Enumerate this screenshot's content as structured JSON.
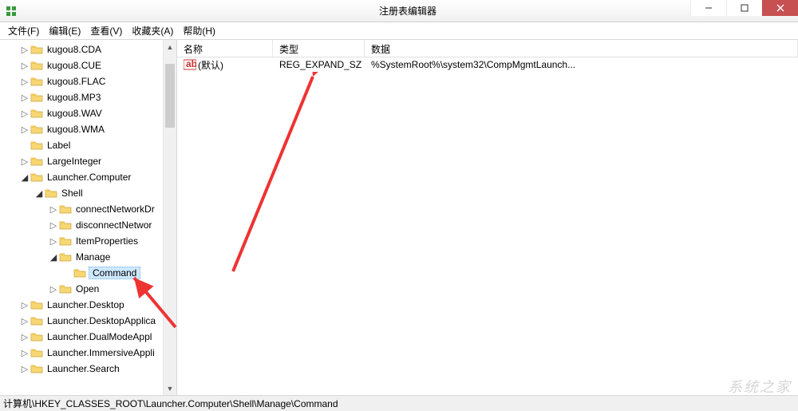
{
  "window": {
    "title": "注册表编辑器"
  },
  "menu": {
    "file": "文件(F)",
    "edit": "编辑(E)",
    "view": "查看(V)",
    "favorites": "收藏夹(A)",
    "help": "帮助(H)"
  },
  "tree": [
    {
      "indent": 0,
      "expander": "▷",
      "label": "kugou8.CDA"
    },
    {
      "indent": 0,
      "expander": "▷",
      "label": "kugou8.CUE"
    },
    {
      "indent": 0,
      "expander": "▷",
      "label": "kugou8.FLAC"
    },
    {
      "indent": 0,
      "expander": "▷",
      "label": "kugou8.MP3"
    },
    {
      "indent": 0,
      "expander": "▷",
      "label": "kugou8.WAV"
    },
    {
      "indent": 0,
      "expander": "▷",
      "label": "kugou8.WMA"
    },
    {
      "indent": 0,
      "expander": "",
      "label": "Label"
    },
    {
      "indent": 0,
      "expander": "▷",
      "label": "LargeInteger"
    },
    {
      "indent": 0,
      "expander": "◢",
      "label": "Launcher.Computer"
    },
    {
      "indent": 1,
      "expander": "◢",
      "label": "Shell"
    },
    {
      "indent": 2,
      "expander": "▷",
      "label": "connectNetworkDr"
    },
    {
      "indent": 2,
      "expander": "▷",
      "label": "disconnectNetwor"
    },
    {
      "indent": 2,
      "expander": "▷",
      "label": "ItemProperties"
    },
    {
      "indent": 2,
      "expander": "◢",
      "label": "Manage"
    },
    {
      "indent": 3,
      "expander": "",
      "label": "Command",
      "selected": true
    },
    {
      "indent": 2,
      "expander": "▷",
      "label": "Open"
    },
    {
      "indent": 0,
      "expander": "▷",
      "label": "Launcher.Desktop"
    },
    {
      "indent": 0,
      "expander": "▷",
      "label": "Launcher.DesktopApplica"
    },
    {
      "indent": 0,
      "expander": "▷",
      "label": "Launcher.DualModeAppl"
    },
    {
      "indent": 0,
      "expander": "▷",
      "label": "Launcher.ImmersiveAppli"
    },
    {
      "indent": 0,
      "expander": "▷",
      "label": "Launcher.Search"
    }
  ],
  "list": {
    "headers": {
      "name": "名称",
      "type": "类型",
      "data": "数据"
    },
    "rows": [
      {
        "name": "(默认)",
        "type": "REG_EXPAND_SZ",
        "data": "%SystemRoot%\\system32\\CompMgmtLaunch..."
      }
    ]
  },
  "statusbar": {
    "path": "计算机\\HKEY_CLASSES_ROOT\\Launcher.Computer\\Shell\\Manage\\Command"
  },
  "watermark": "系统之家"
}
